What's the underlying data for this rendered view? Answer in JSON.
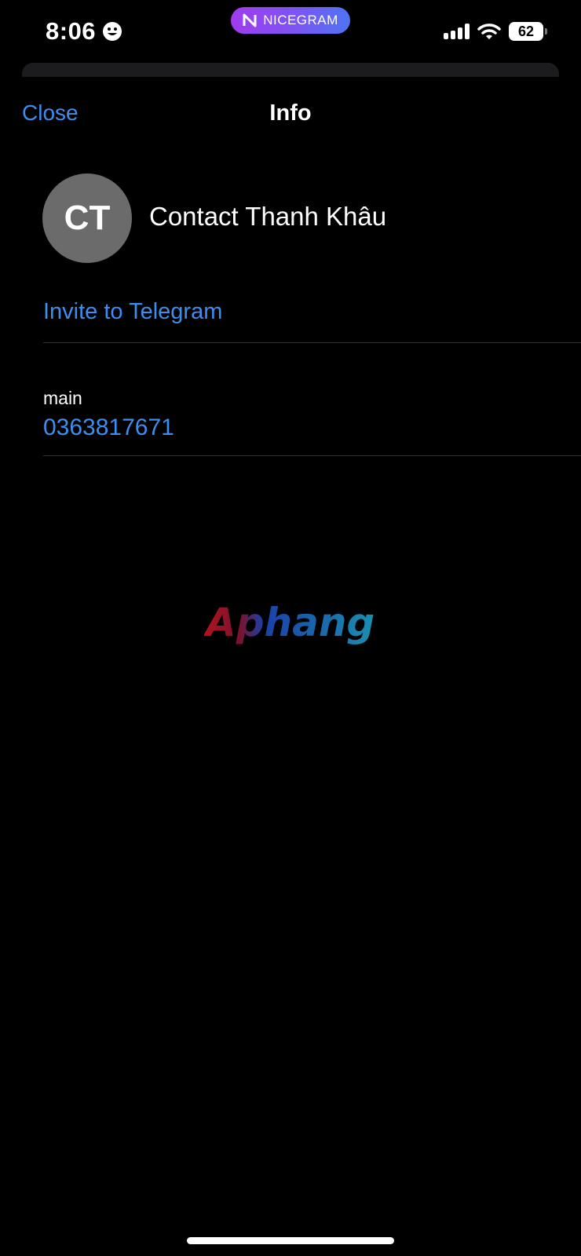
{
  "status_bar": {
    "time": "8:06",
    "app_badge": "NICEGRAM",
    "battery": "62",
    "icons": [
      "smile-icon",
      "signal-icon",
      "wifi-icon",
      "battery-icon"
    ]
  },
  "nav": {
    "close_label": "Close",
    "title": "Info"
  },
  "contact": {
    "initials": "CT",
    "name": "Contact Thanh Khâu",
    "invite_label": "Invite to Telegram",
    "phone_label": "main",
    "phone_number": "0363817671"
  },
  "watermark": {
    "text": "Aphang"
  },
  "colors": {
    "background": "#000000",
    "accent": "#3e8ef0",
    "avatar": "#6b6b6b",
    "divider": "#2e2e30",
    "pill_start": "#a13bf0",
    "pill_end": "#4f74f5"
  }
}
